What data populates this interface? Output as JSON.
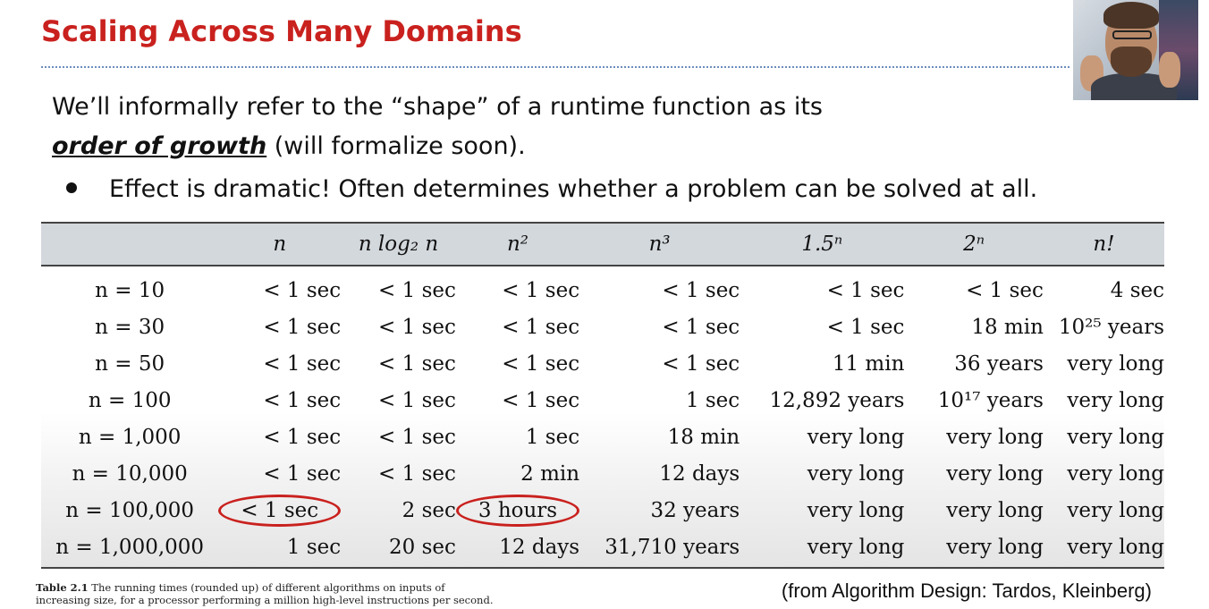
{
  "slide": {
    "title": "Scaling Across Many Domains",
    "intro_line1": "We’ll informally refer to the “shape” of a runtime function as its",
    "intro_term": "order of growth",
    "intro_rest": " (will formalize soon).",
    "bullet": "Effect is dramatic! Often determines whether a problem can be solved at all."
  },
  "table": {
    "headers": [
      "",
      "n",
      "n log₂ n",
      "n²",
      "n³",
      "1.5ⁿ",
      "2ⁿ",
      "n!"
    ],
    "rows": [
      [
        "n = 10",
        "< 1 sec",
        "< 1 sec",
        "< 1 sec",
        "< 1 sec",
        "< 1 sec",
        "< 1 sec",
        "4 sec"
      ],
      [
        "n = 30",
        "< 1 sec",
        "< 1 sec",
        "< 1 sec",
        "< 1 sec",
        "< 1 sec",
        "18 min",
        "10²⁵ years"
      ],
      [
        "n = 50",
        "< 1 sec",
        "< 1 sec",
        "< 1 sec",
        "< 1 sec",
        "11 min",
        "36 years",
        "very long"
      ],
      [
        "n = 100",
        "< 1 sec",
        "< 1 sec",
        "< 1 sec",
        "1 sec",
        "12,892 years",
        "10¹⁷ years",
        "very long"
      ],
      [
        "n = 1,000",
        "< 1 sec",
        "< 1 sec",
        "1 sec",
        "18 min",
        "very long",
        "very long",
        "very long"
      ],
      [
        "n = 10,000",
        "< 1 sec",
        "< 1 sec",
        "2 min",
        "12 days",
        "very long",
        "very long",
        "very long"
      ],
      [
        "n = 100,000",
        "< 1 sec",
        "2 sec",
        "3 hours",
        "32 years",
        "very long",
        "very long",
        "very long"
      ],
      [
        "n = 1,000,000",
        "1 sec",
        "20 sec",
        "12 days",
        "31,710 years",
        "very long",
        "very long",
        "very long"
      ]
    ],
    "circled_cells": [
      "n = 100,000 / n",
      "n = 100,000 / n²"
    ],
    "circle_color": "#c9211e"
  },
  "caption": {
    "label": "Table 2.1",
    "line1": " The running times (rounded up) of different algorithms on inputs of",
    "line2": "increasing size, for a processor performing a million high-level instructions per second."
  },
  "source": "(from Algorithm Design: Tardos, Kleinberg)",
  "colors": {
    "title": "#c9211e",
    "divider": "#6c8ebf",
    "table_header_band": "#d3d8dd"
  },
  "webcam": {
    "icon": "presenter-webcam-icon"
  }
}
